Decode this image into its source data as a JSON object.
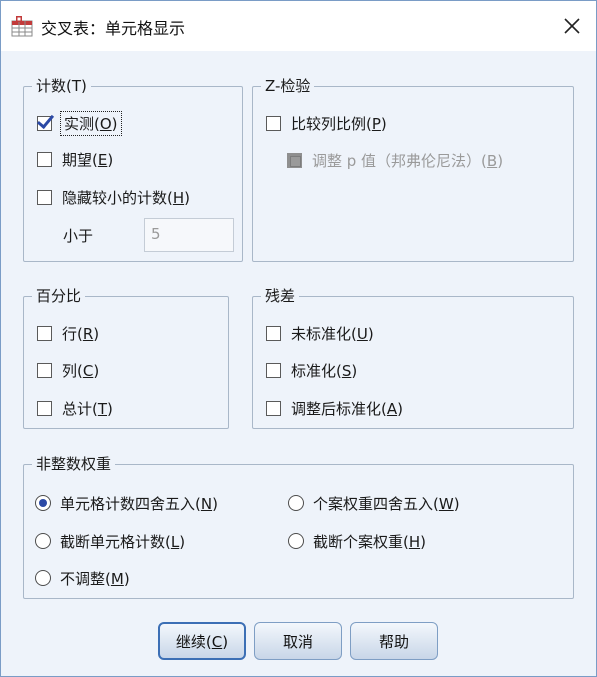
{
  "window": {
    "title": "交叉表：单元格显示",
    "close_symbol": "✕"
  },
  "counts": {
    "legend": "计数(T)",
    "observed": {
      "text": "实测(",
      "key": "O",
      "suffix": ")",
      "checked": true
    },
    "expected": {
      "text": "期望(",
      "key": "E",
      "suffix": ")",
      "checked": false
    },
    "hide_small": {
      "text": "隐藏较小的计数(",
      "key": "H",
      "suffix": ")",
      "checked": false
    },
    "less_than_label": "小于",
    "less_than_value": "5"
  },
  "z_test": {
    "legend": "Z-检验",
    "compare_props": {
      "text": "比较列比例(",
      "key": "P",
      "suffix": ")",
      "checked": false
    },
    "adjust_p": {
      "text": "调整 p 值（邦弗伦尼法）(",
      "key": "B",
      "suffix": ")",
      "disabled": true
    }
  },
  "percentages": {
    "legend": "百分比",
    "row": {
      "text": "行(",
      "key": "R",
      "suffix": ")"
    },
    "column": {
      "text": "列(",
      "key": "C",
      "suffix": ")"
    },
    "total": {
      "text": "总计(",
      "key": "T",
      "suffix": ")"
    }
  },
  "residuals": {
    "legend": "残差",
    "unstandardized": {
      "text": "未标准化(",
      "key": "U",
      "suffix": ")"
    },
    "standardized": {
      "text": "标准化(",
      "key": "S",
      "suffix": ")"
    },
    "adjusted": {
      "text": "调整后标准化(",
      "key": "A",
      "suffix": ")"
    }
  },
  "noninteger": {
    "legend": "非整数权重",
    "round_cell": {
      "text": "单元格计数四舍五入(",
      "key": "N",
      "suffix": ")",
      "selected": true
    },
    "round_case": {
      "text": "个案权重四舍五入(",
      "key": "W",
      "suffix": ")"
    },
    "truncate_cell": {
      "text": "截断单元格计数(",
      "key": "L",
      "suffix": ")"
    },
    "truncate_case": {
      "text": "截断个案权重(",
      "key": "H",
      "suffix": ")"
    },
    "no_adjust": {
      "text": "不调整(",
      "key": "M",
      "suffix": ")"
    }
  },
  "buttons": {
    "continue": {
      "text": "继续(",
      "key": "C",
      "suffix": ")"
    },
    "cancel": "取消",
    "help": "帮助"
  },
  "colors": {
    "accent": "#2c4aa6",
    "dialog_bg": "#eef3fa",
    "border": "#7a9cc6"
  }
}
